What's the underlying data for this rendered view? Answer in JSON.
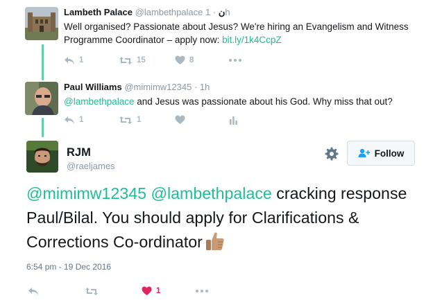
{
  "colors": {
    "accent": "#1dbf94",
    "thread": "#5fd1a5",
    "icon": "#aab8c2",
    "like": "#e0245e"
  },
  "tweet1": {
    "name": "Lambeth Palace",
    "handle": "@lambethpalace",
    "name_suffix": "ن",
    "time": "1h",
    "text": "Well organised? Passionate about Jesus? We're hiring an Evangelism and Witness Programme Coordinator – apply now:",
    "link": "bit.ly/1k4CcpZ",
    "reply_count": "1",
    "retweet_count": "15",
    "like_count": "8"
  },
  "tweet2": {
    "name": "Paul Williams",
    "handle": "@mimimw12345",
    "time": "1h",
    "mention": "@lambethpalace",
    "text": " and Jesus was passionate about his God. Why miss that out?",
    "reply_count": "1",
    "retweet_count": "1"
  },
  "main": {
    "name": "RJM",
    "handle": "@raeljames",
    "follow_label": "Follow",
    "mention1": "@mimimw12345",
    "mention2": "@lambethpalace",
    "text": " cracking response Paul/Bilal. You should apply for Clarifications & Corrections Co-ordinator",
    "date": "6:54 pm - 19 Dec 2016",
    "like_count": "1"
  },
  "separator": "·"
}
